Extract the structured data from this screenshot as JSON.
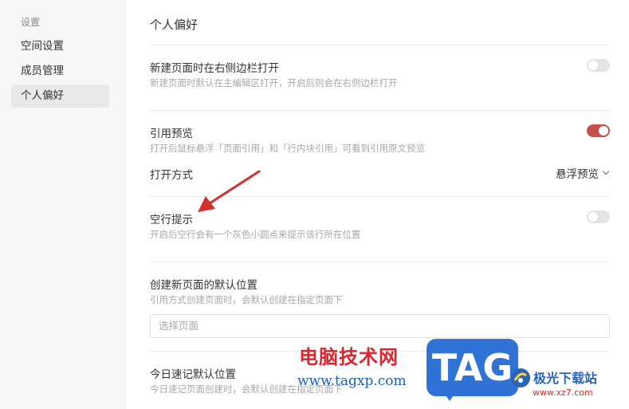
{
  "sidebar": {
    "title": "设置",
    "items": [
      {
        "label": "空间设置",
        "active": false
      },
      {
        "label": "成员管理",
        "active": false
      },
      {
        "label": "个人偏好",
        "active": true
      }
    ]
  },
  "main": {
    "title": "个人偏好",
    "settings": [
      {
        "title": "新建页面时在右侧边栏打开",
        "description": "新建页面时默认在主编辑区打开，开启后则会在右侧边栏打开",
        "enabled": false
      },
      {
        "title": "引用预览",
        "description": "打开后鼠标悬浮「页面引用」和「行内块引用」可看到引用原文预览",
        "enabled": true
      },
      {
        "title": "空行提示",
        "description": "开启后空行会有一个灰色小圆点来提示该行所在位置",
        "enabled": false
      },
      {
        "title": "创建新页面的默认位置",
        "description": "引用方式创建页面时，会默认创建在指定页面下"
      },
      {
        "title": "今日速记默认位置",
        "description": "今日速记页面创建时，会默认创建在指定页面下"
      }
    ],
    "open_mode": {
      "label": "打开方式",
      "value": "悬浮预览"
    },
    "page_select": {
      "placeholder": "选择页面"
    }
  },
  "watermark": {
    "site_name": "电脑技术网",
    "site_url": "www.tagxp.com",
    "badge": "TAG",
    "site2_name": "极光下载站",
    "site2_url": "www.xz7.com"
  },
  "colors": {
    "toggle_on": "#c8504a",
    "toggle_off": "#e3e3e3",
    "annotation_arrow": "#d0312d",
    "badge_blue": "#2f73d6"
  }
}
